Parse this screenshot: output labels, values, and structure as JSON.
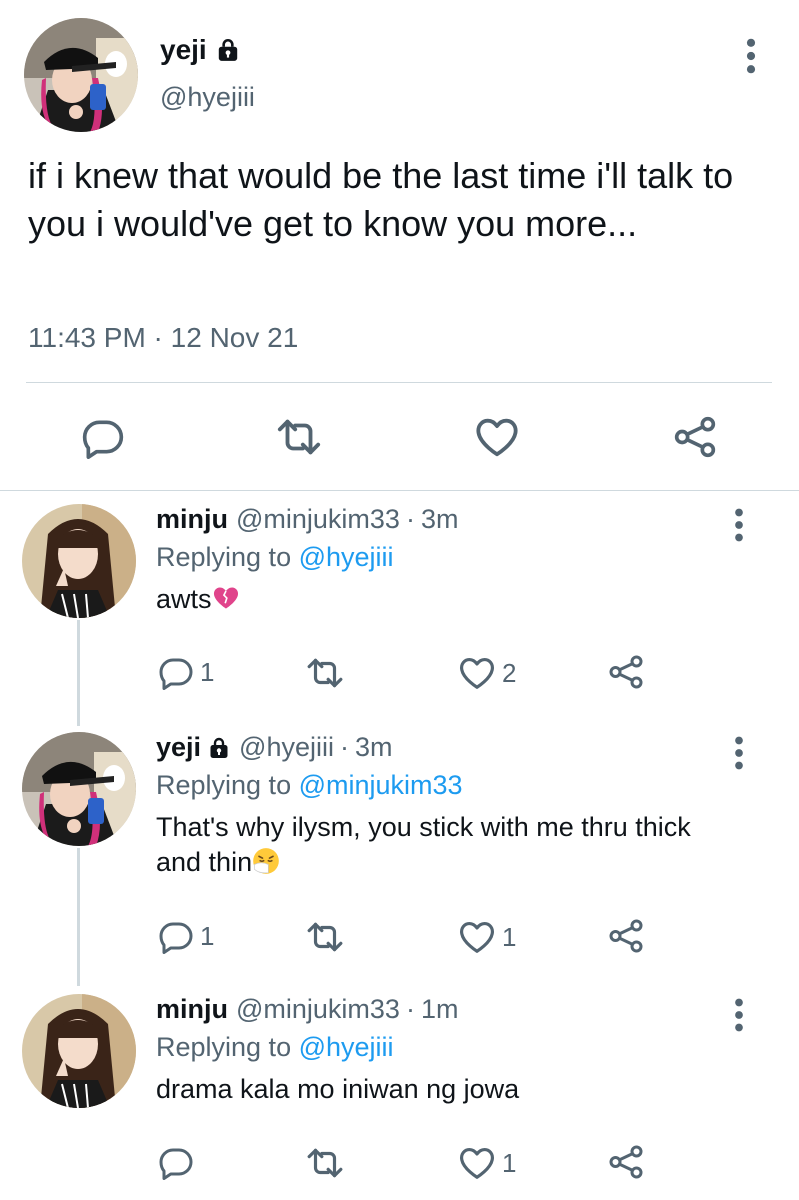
{
  "main_tweet": {
    "name": "yeji",
    "handle": "@hyejiii",
    "text": "if i knew that would be the last time i'll talk to you i would've get to know you more...",
    "timestamp": "11:43 PM · 12 Nov 21",
    "icons": [
      "lock-icon",
      "more-icon",
      "reply-icon",
      "retweet-icon",
      "like-icon",
      "share-icon"
    ]
  },
  "replies": [
    {
      "name": "minju",
      "handle": "@minjukim33",
      "dot": "·",
      "time": "3m",
      "replying_prefix": "Replying to",
      "replying_to": "@hyejiii",
      "text": "awts",
      "emoji": "broken-heart",
      "reply_count": "1",
      "like_count": "2"
    },
    {
      "name": "yeji",
      "handle": "@hyejiii",
      "dot": "·",
      "time": "3m",
      "replying_prefix": "Replying to",
      "replying_to": "@minjukim33",
      "text": "That's why ilysm, you stick with me thru thick and thin",
      "emoji": "sneezing-face",
      "reply_count": "1",
      "like_count": "1"
    },
    {
      "name": "minju",
      "handle": "@minjukim33",
      "dot": "·",
      "time": "1m",
      "replying_prefix": "Replying to",
      "replying_to": "@hyejiii",
      "text": "drama kala mo iniwan ng jowa",
      "reply_count": "",
      "like_count": "1"
    }
  ],
  "colors": {
    "text": "#0f1419",
    "secondary": "#536471",
    "link": "#1d9bf0",
    "divider": "#cfd9de"
  }
}
